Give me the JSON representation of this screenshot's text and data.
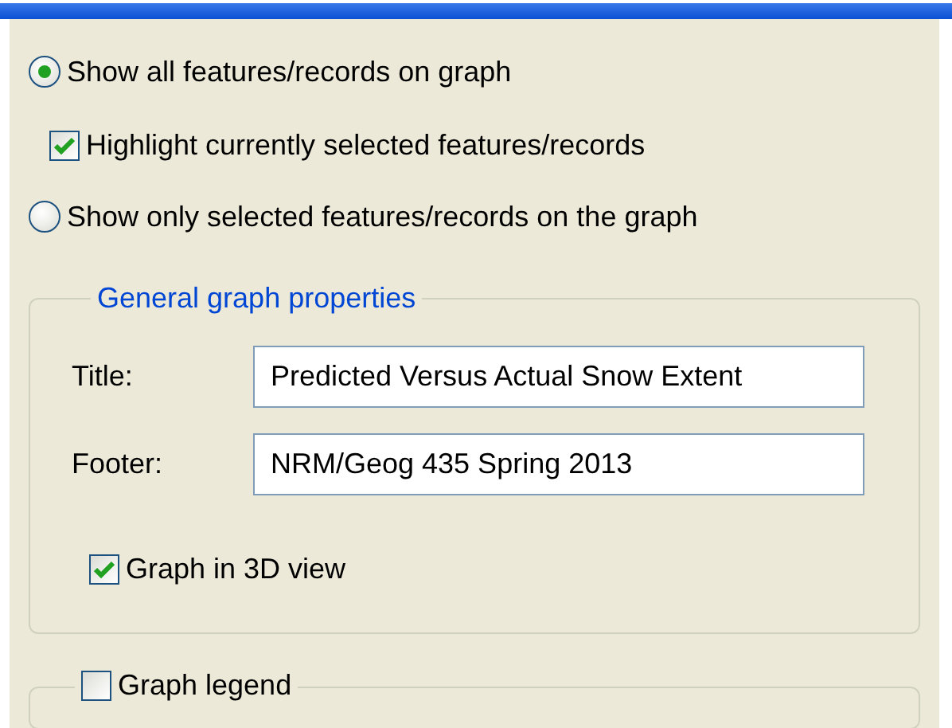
{
  "options": [
    {
      "kind": "radio",
      "label": "Show all features/records on graph",
      "selected": true
    },
    {
      "kind": "checkbox",
      "label": "Highlight currently selected features/records",
      "checked": true
    },
    {
      "kind": "radio",
      "label": "Show only selected features/records on the graph",
      "selected": false
    }
  ],
  "general_group": {
    "title": "General graph properties",
    "fields": [
      {
        "label": "Title:",
        "value": "Predicted Versus Actual Snow Extent"
      },
      {
        "label": "Footer:",
        "value": "NRM/Geog 435 Spring 2013"
      }
    ],
    "graph_3d": {
      "label": "Graph in 3D view",
      "checked": true
    }
  },
  "legend_group": {
    "label": "Graph legend",
    "checked": false
  }
}
